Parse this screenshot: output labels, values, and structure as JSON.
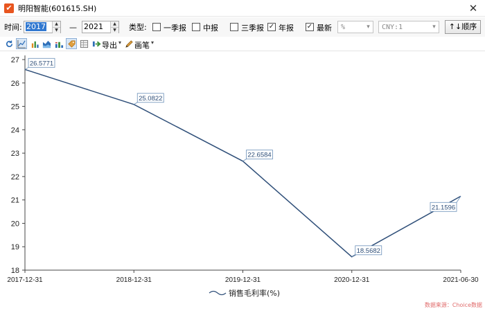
{
  "window": {
    "title": "明阳智能(601615.SH)",
    "close_glyph": "✕"
  },
  "filters": {
    "time_label": "时间:",
    "start_year": "2017",
    "dash": "—",
    "end_year": "2021",
    "type_label": "类型:",
    "q1": {
      "label": "一季报",
      "checked": false
    },
    "mid": {
      "label": "中报",
      "checked": false
    },
    "q3": {
      "label": "三季报",
      "checked": false
    },
    "annual": {
      "label": "年报",
      "checked": true
    },
    "latest": {
      "label": "最新",
      "checked": true
    },
    "unit_select": "%",
    "currency_select": "CNY:1",
    "sort_button": "↑↓顺序"
  },
  "toolbar": {
    "export_label": "导出",
    "brush_label": "画笔"
  },
  "chart_data": {
    "type": "line",
    "x": [
      "2017-12-31",
      "2018-12-31",
      "2019-12-31",
      "2020-12-31",
      "2021-06-30"
    ],
    "series": [
      {
        "name": "销售毛利率(%)",
        "values": [
          26.5771,
          25.0822,
          22.6584,
          18.5682,
          21.1596
        ],
        "labels": [
          "26.5771",
          "25.0822",
          "22.6584",
          "18.5682",
          "21.1596"
        ]
      }
    ],
    "yticks": [
      18,
      19,
      20,
      21,
      22,
      23,
      24,
      25,
      26,
      27
    ],
    "ylim": [
      18,
      27
    ],
    "legend_position": "bottom-center",
    "line_color": "#2f4f79",
    "grid": false
  },
  "watermark": "数据来源：Choice数据"
}
